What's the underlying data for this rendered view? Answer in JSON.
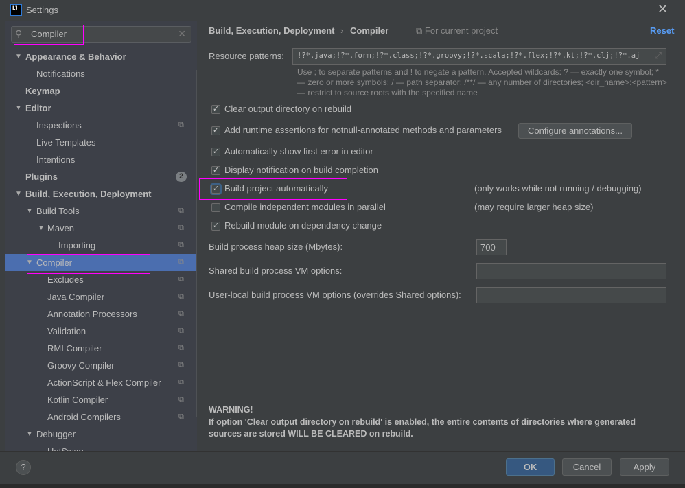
{
  "window": {
    "title": "Settings",
    "logo": "IJ",
    "close_icon": "close-icon"
  },
  "search": {
    "value": "Compiler"
  },
  "tree": [
    {
      "label": "Appearance & Behavior",
      "level": 0,
      "bold": true,
      "arrow": true
    },
    {
      "label": "Notifications",
      "level": 1
    },
    {
      "label": "Keymap",
      "level": 0,
      "bold": true
    },
    {
      "label": "Editor",
      "level": 0,
      "bold": true,
      "arrow": true
    },
    {
      "label": "Inspections",
      "level": 1,
      "copy": true
    },
    {
      "label": "Live Templates",
      "level": 1
    },
    {
      "label": "Intentions",
      "level": 1
    },
    {
      "label": "Plugins",
      "level": 0,
      "bold": true,
      "badge": "2"
    },
    {
      "label": "Build, Execution, Deployment",
      "level": 0,
      "bold": true,
      "arrow": true
    },
    {
      "label": "Build Tools",
      "level": 1,
      "arrow": true,
      "copy": true
    },
    {
      "label": "Maven",
      "level": 2,
      "arrow": true,
      "copy": true
    },
    {
      "label": "Importing",
      "level": 3,
      "copy": true
    },
    {
      "label": "Compiler",
      "level": 1,
      "arrow": true,
      "copy": true,
      "selected": true
    },
    {
      "label": "Excludes",
      "level": 2,
      "copy": true
    },
    {
      "label": "Java Compiler",
      "level": 2,
      "copy": true
    },
    {
      "label": "Annotation Processors",
      "level": 2,
      "copy": true
    },
    {
      "label": "Validation",
      "level": 2,
      "copy": true
    },
    {
      "label": "RMI Compiler",
      "level": 2,
      "copy": true
    },
    {
      "label": "Groovy Compiler",
      "level": 2,
      "copy": true
    },
    {
      "label": "ActionScript & Flex Compiler",
      "level": 2,
      "copy": true
    },
    {
      "label": "Kotlin Compiler",
      "level": 2,
      "copy": true
    },
    {
      "label": "Android Compilers",
      "level": 2,
      "copy": true
    },
    {
      "label": "Debugger",
      "level": 1,
      "arrow": true
    },
    {
      "label": "HotSwap",
      "level": 2
    }
  ],
  "header": {
    "crumb1": "Build, Execution, Deployment",
    "sep": "›",
    "crumb2": "Compiler",
    "scope": "For current project",
    "reset": "Reset"
  },
  "resource": {
    "label": "Resource patterns:",
    "value": "!?*.java;!?*.form;!?*.class;!?*.groovy;!?*.scala;!?*.flex;!?*.kt;!?*.clj;!?*.aj",
    "hint": "Use ; to separate patterns and ! to negate a pattern. Accepted wildcards: ? — exactly one symbol; * — zero or more symbols; / — path separator; /**/ — any number of directories; <dir_name>:<pattern> — restrict to source roots with the specified name"
  },
  "options": [
    {
      "label": "Clear output directory on rebuild",
      "checked": true
    },
    {
      "label": "Add runtime assertions for notnull-annotated methods and parameters",
      "checked": true
    },
    {
      "label": "Automatically show first error in editor",
      "checked": true
    },
    {
      "label": "Display notification on build completion",
      "checked": true
    },
    {
      "label": "Build project automatically",
      "checked": true,
      "note": "(only works while not running / debugging)"
    },
    {
      "label": "Compile independent modules in parallel",
      "checked": false,
      "note": "(may require larger heap size)"
    },
    {
      "label": "Rebuild module on dependency change",
      "checked": true
    }
  ],
  "configure_button": "Configure annotations...",
  "heap": {
    "label": "Build process heap size (Mbytes):",
    "value": "700"
  },
  "shared_vm": {
    "label": "Shared build process VM options:",
    "value": ""
  },
  "user_vm": {
    "label": "User-local build process VM options (overrides Shared options):",
    "value": ""
  },
  "warning": {
    "title": "WARNING!",
    "text": "If option 'Clear output directory on rebuild' is enabled, the entire contents of directories where generated sources are stored WILL BE CLEARED on rebuild."
  },
  "footer": {
    "help": "?",
    "ok": "OK",
    "cancel": "Cancel",
    "apply": "Apply"
  },
  "colors": {
    "selection": "#4b6eaf",
    "link": "#589df6",
    "highlight": "#ff00ff",
    "ok": "#365880"
  }
}
